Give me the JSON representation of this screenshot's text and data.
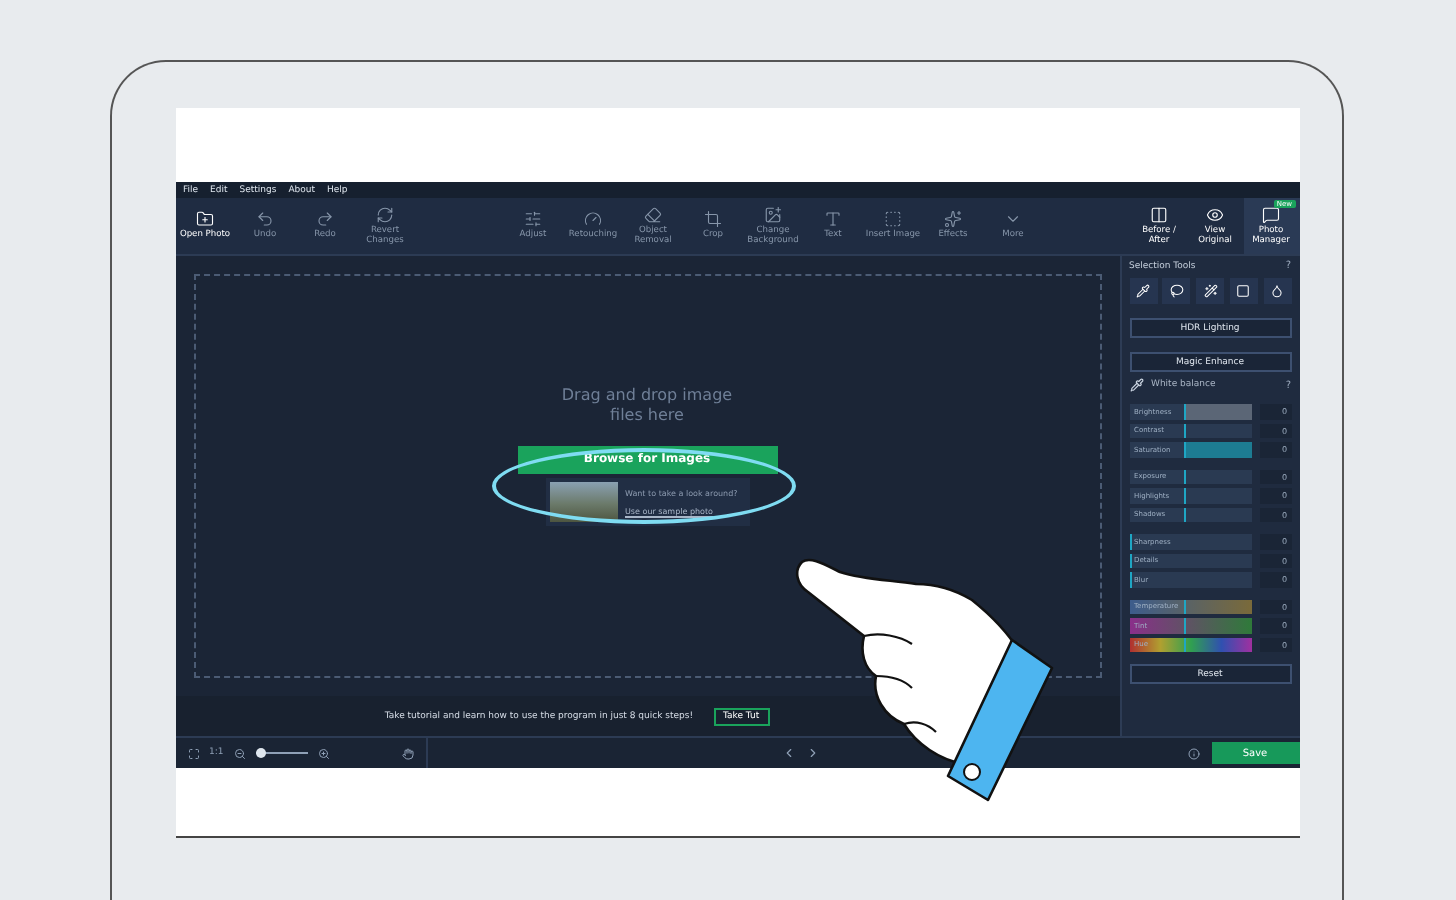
{
  "menu": [
    "File",
    "Edit",
    "Settings",
    "About",
    "Help"
  ],
  "toolbar": {
    "left": [
      {
        "label": "Open Photo",
        "disabled": false
      },
      {
        "label": "Undo",
        "disabled": true
      },
      {
        "label": "Redo",
        "disabled": true
      },
      {
        "label": "Revert Changes",
        "disabled": true
      }
    ],
    "tools": [
      {
        "label": "Adjust",
        "disabled": true
      },
      {
        "label": "Retouching",
        "disabled": true
      },
      {
        "label": "Object Removal",
        "disabled": true
      },
      {
        "label": "Crop",
        "disabled": true
      },
      {
        "label": "Change Background",
        "disabled": true
      },
      {
        "label": "Text",
        "disabled": true
      },
      {
        "label": "Insert Image",
        "disabled": true
      },
      {
        "label": "Effects",
        "disabled": true
      },
      {
        "label": "More",
        "disabled": true
      }
    ],
    "right": [
      {
        "label": "Before / After",
        "selected": false
      },
      {
        "label": "View Original",
        "selected": false
      },
      {
        "label": "Photo Manager",
        "selected": true,
        "badge": "New"
      }
    ]
  },
  "dropzone": {
    "text": "Drag and drop image files here",
    "button": "Browse for Images",
    "sample_question": "Want to take a look around?",
    "sample_link": "Use our sample photo"
  },
  "tutorial": {
    "text": "Take tutorial and learn how to use the program in just 8 quick steps!",
    "button": "Take Tut"
  },
  "bottom_bar": {
    "zoom_label": "1:1",
    "zoom_slider": {
      "level": 0.12
    }
  },
  "panel": {
    "title": "Selection Tools",
    "help": "?",
    "hdr": "HDR Lighting",
    "magic": "Magic Enhance",
    "white_balance": "White balance",
    "wb_help": "?",
    "groups": [
      [
        {
          "label": "Brightness",
          "kind": "neutral",
          "level": 0.45,
          "value": "0"
        },
        {
          "label": "Contrast",
          "kind": "plain",
          "level": 0.45,
          "value": "0"
        },
        {
          "label": "Saturation",
          "kind": "saturation",
          "level": 0.45,
          "value": "0"
        }
      ],
      [
        {
          "label": "Exposure",
          "kind": "plain",
          "level": 0.45,
          "value": "0"
        },
        {
          "label": "Highlights",
          "kind": "plain",
          "level": 0.45,
          "value": "0"
        },
        {
          "label": "Shadows",
          "kind": "plain",
          "level": 0.45,
          "value": "0"
        }
      ],
      [
        {
          "label": "Sharpness",
          "kind": "plain",
          "level": 0,
          "value": "0"
        },
        {
          "label": "Details",
          "kind": "plain",
          "level": 0,
          "value": "0"
        },
        {
          "label": "Blur",
          "kind": "plain",
          "level": 0,
          "value": "0"
        }
      ],
      [
        {
          "label": "Temperature",
          "kind": "temperature",
          "level": 0.45,
          "value": "0"
        },
        {
          "label": "Tint",
          "kind": "tint",
          "level": 0.45,
          "value": "0"
        },
        {
          "label": "Hue",
          "kind": "hue",
          "level": 0.45,
          "value": "0"
        }
      ]
    ],
    "reset": "Reset",
    "save": "Save"
  }
}
